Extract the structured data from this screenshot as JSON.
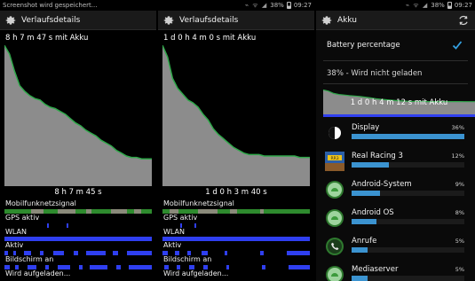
{
  "panels": [
    {
      "statusbar": {
        "notification": "Screenshot wird gespeichert...",
        "battery_pct": "38%",
        "time": "09:27"
      },
      "title": "Verlaufsdetails",
      "history_top": "8 h 7 m 47 s mit Akku",
      "history_bottom": "8 h 7 m 45 s",
      "battery_curve": [
        0.98,
        0.92,
        0.8,
        0.7,
        0.66,
        0.63,
        0.61,
        0.6,
        0.57,
        0.55,
        0.54,
        0.52,
        0.5,
        0.47,
        0.44,
        0.42,
        0.39,
        0.37,
        0.35,
        0.32,
        0.3,
        0.28,
        0.25,
        0.23,
        0.21,
        0.2,
        0.2,
        0.19,
        0.19,
        0.19
      ],
      "signals": {
        "mobile": "Mobilfunknetzsignal",
        "gps": "GPS aktiv",
        "wlan": "WLAN",
        "active": "Aktiv",
        "screen": "Bildschirm an",
        "wake": "Wird aufgeladen..."
      }
    },
    {
      "statusbar": {
        "notification": "",
        "battery_pct": "38%",
        "time": "09:27"
      },
      "title": "Verlaufsdetails",
      "history_top": "1 d 0 h 4 m 0 s mit Akku",
      "history_bottom": "1 d 0 h 3 m 40 s",
      "battery_curve": [
        0.98,
        0.9,
        0.75,
        0.68,
        0.64,
        0.6,
        0.58,
        0.55,
        0.5,
        0.46,
        0.4,
        0.36,
        0.33,
        0.3,
        0.27,
        0.25,
        0.23,
        0.22,
        0.22,
        0.22,
        0.21,
        0.21,
        0.21,
        0.21,
        0.21,
        0.21,
        0.21,
        0.2,
        0.2,
        0.2
      ],
      "signals": {
        "mobile": "Mobilfunknetzsignal",
        "gps": "GPS aktiv",
        "wlan": "WLAN",
        "active": "Aktiv",
        "screen": "Bildschirm an",
        "wake": "Wird aufgeladen..."
      }
    }
  ],
  "akku": {
    "statusbar": {
      "battery_pct": "38%",
      "time": "09:27"
    },
    "title": "Akku",
    "setting_label": "Battery percentage",
    "setting_checked": true,
    "battery_status": "38% - Wird nicht geladen",
    "mini_label": "1 d 0 h 4 m 12 s mit Akku",
    "apps": [
      {
        "name": "Display",
        "percent": "36%",
        "value": 36,
        "icon": "display-icon"
      },
      {
        "name": "Real Racing 3",
        "percent": "12%",
        "value": 12,
        "icon": "real-racing-icon"
      },
      {
        "name": "Android-System",
        "percent": "9%",
        "value": 9,
        "icon": "android-system-icon"
      },
      {
        "name": "Android OS",
        "percent": "8%",
        "value": 8,
        "icon": "android-os-icon"
      },
      {
        "name": "Anrufe",
        "percent": "5%",
        "value": 5,
        "icon": "phone-icon"
      },
      {
        "name": "Mediaserver",
        "percent": "5%",
        "value": 5,
        "icon": "mediaserver-icon"
      }
    ]
  },
  "colors": {
    "chart_fill": "#8c8c8c",
    "chart_line": "#2fa84a",
    "signal_green": "#2e8b2e",
    "signal_gray": "#8a8a7a",
    "signal_blue": "#2f3ff0",
    "app_bar": "#3b93d0",
    "check_blue": "#34a0e0"
  }
}
